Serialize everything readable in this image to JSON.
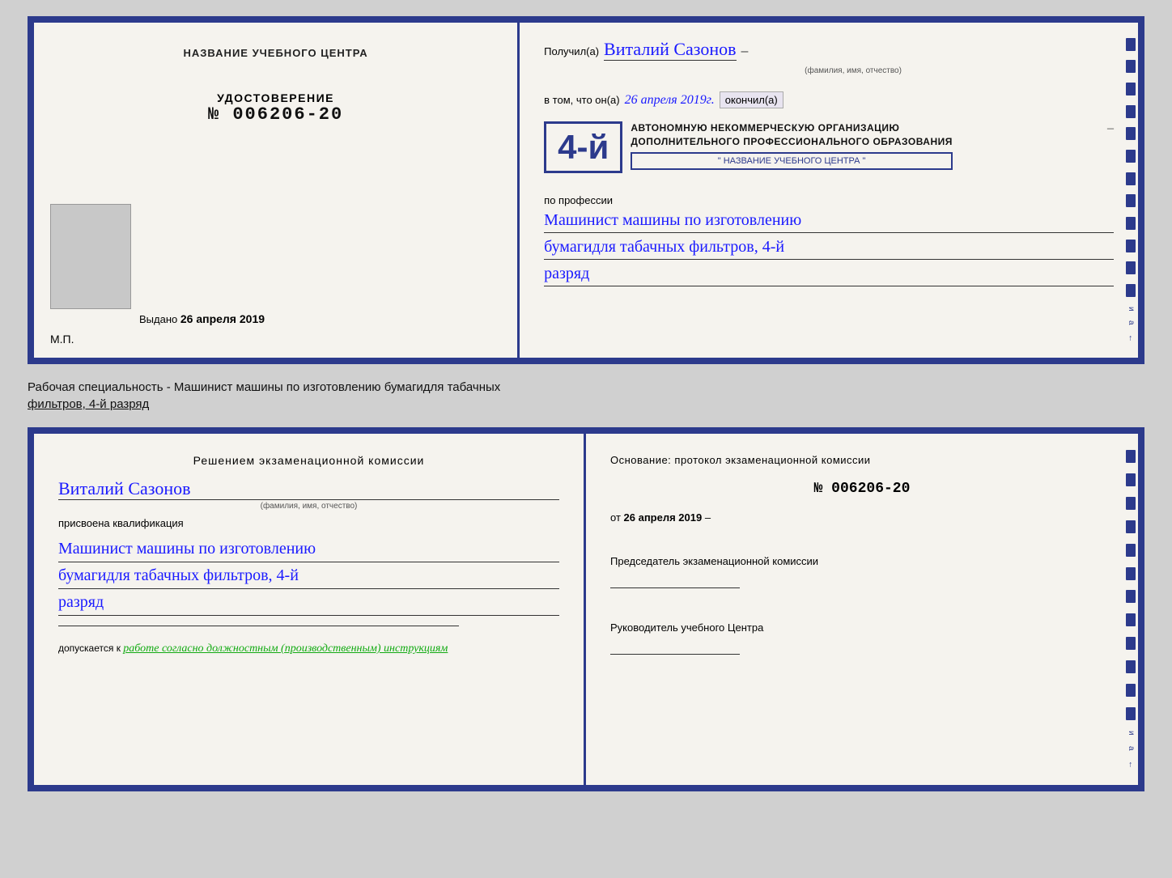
{
  "top_doc": {
    "left": {
      "center_title": "НАЗВАНИЕ УЧЕБНОГО ЦЕНТРА",
      "cert_label": "УДОСТОВЕРЕНИЕ",
      "cert_number": "№ 006206-20",
      "issued_label": "Выдано",
      "issued_date": "26 апреля 2019",
      "mp_label": "М.П."
    },
    "right": {
      "poluchil_prefix": "Получил(а)",
      "recipient_name": "Виталий Сазонов",
      "recipient_sublabel": "(фамилия, имя, отчество)",
      "dash": "–",
      "vtom_prefix": "в том, что он(а)",
      "date_hw": "26 апреля 2019г.",
      "okonchil_label": "окончил(а)",
      "stamp_num": "4-й",
      "org_line1": "АВТОНОМНУЮ НЕКОММЕРЧЕСКУЮ ОРГАНИЗАЦИЮ",
      "org_line2": "ДОПОЛНИТЕЛЬНОГО ПРОФЕССИОНАЛЬНОГО ОБРАЗОВАНИЯ",
      "org_name_stamp": "\" НАЗВАНИЕ УЧЕБНОГО ЦЕНТРА \"",
      "profession_label": "по профессии",
      "profession_hw_1": "Машинист машины по изготовлению",
      "profession_hw_2": "бумагидля табачных фильтров, 4-й",
      "profession_hw_3": "разряд"
    }
  },
  "between_label": {
    "text1": "Рабочая специальность - Машинист машины по изготовлению бумагидля табачных",
    "text2": "фильтров, 4-й разряд"
  },
  "bottom_doc": {
    "left": {
      "decision_title": "Решением  экзаменационной  комиссии",
      "person_hw": "Виталий Сазонов",
      "fio_label": "(фамилия, имя, отчество)",
      "assigned_label": "присвоена квалификация",
      "qual_hw_1": "Машинист машины по изготовлению",
      "qual_hw_2": "бумагидля табачных фильтров, 4-й",
      "qual_hw_3": "разряд",
      "allowed_prefix": "допускается к",
      "allowed_hw": "работе согласно должностным (производственным) инструкциям"
    },
    "right": {
      "basis_title": "Основание:  протокол  экзаменационной  комиссии",
      "protocol_num": "№  006206-20",
      "from_prefix": "от",
      "from_date": "26 апреля 2019",
      "chairman_label": "Председатель экзаменационной комиссии",
      "head_label": "Руководитель учебного Центра"
    }
  },
  "strips_count": 12,
  "colors": {
    "border": "#2c3a8c",
    "handwritten": "#1a1aff",
    "background": "#f5f3ee"
  }
}
